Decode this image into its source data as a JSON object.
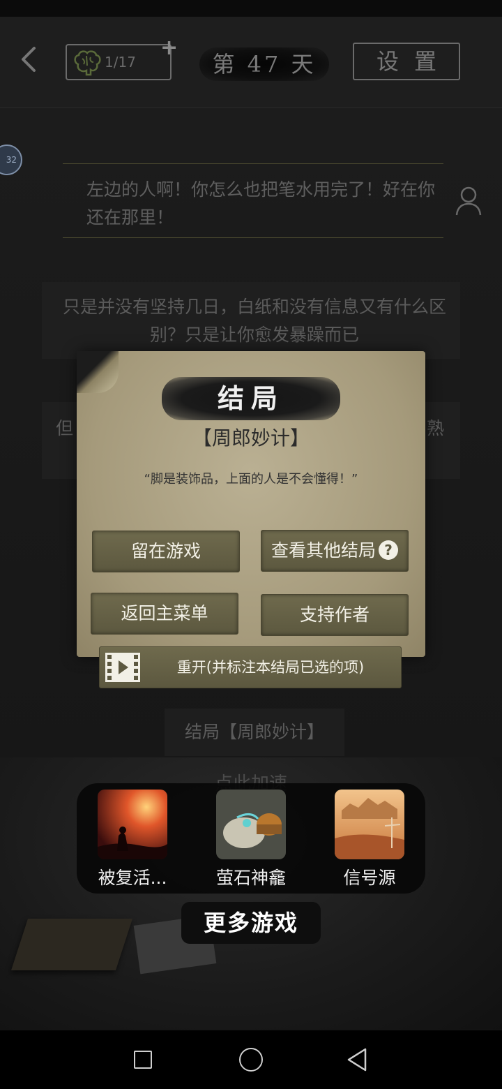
{
  "header": {
    "brain_count": "1/17",
    "day_label": "第 47 天",
    "settings_label": "设置"
  },
  "chat": {
    "avatar_text": "32",
    "message1": "左边的人啊！你怎么也把笔水用完了！好在你还在那里！",
    "message2": "只是并没有坚持几日，白纸和没有信息又有什么区别？只是让你愈发暴躁而已",
    "message3_left": "但",
    "message3_right": "熟"
  },
  "dialog": {
    "title": "结局",
    "ending_name": "【周郎妙计】",
    "quote": "“脚是装饰品，上面的人是不会懂得！”",
    "stay_button": "留在游戏",
    "other_endings_button": "查看其他结局",
    "help_symbol": "?",
    "main_menu_button": "返回主菜单",
    "support_button": "支持作者",
    "restart_button": "重开(并标注本结局已选的项)"
  },
  "below": {
    "ending_label": "结局【周郎妙计】",
    "speedup_label": "点此加速"
  },
  "more_games": {
    "games": [
      {
        "name": "被复活..."
      },
      {
        "name": "萤石神龕"
      },
      {
        "name": "信号源"
      }
    ],
    "label": "更多游戏"
  },
  "colors": {
    "button_bg": "#66614a",
    "parchment": "#a59a7b",
    "background": "#141414"
  }
}
